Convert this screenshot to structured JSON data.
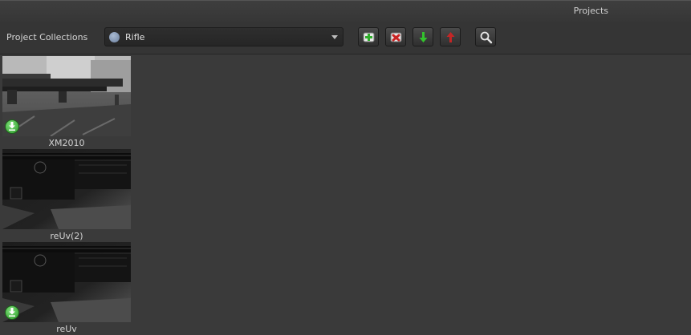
{
  "window": {
    "title": "Projects"
  },
  "toolbar": {
    "collections_label": "Project Collections",
    "selected_collection": "Rifle",
    "collection_dot_color": "#7d91af",
    "buttons": [
      {
        "name": "add-project-button",
        "icon": "add-icon"
      },
      {
        "name": "remove-project-button",
        "icon": "remove-icon"
      },
      {
        "name": "download-button",
        "icon": "arrow-down-icon"
      },
      {
        "name": "upload-button",
        "icon": "arrow-up-icon"
      },
      {
        "name": "search-button",
        "icon": "search-icon"
      }
    ]
  },
  "projects": [
    {
      "name": "XM2010",
      "downloaded": true
    },
    {
      "name": "reUv(2)",
      "downloaded": false
    },
    {
      "name": "reUv",
      "downloaded": true
    }
  ]
}
